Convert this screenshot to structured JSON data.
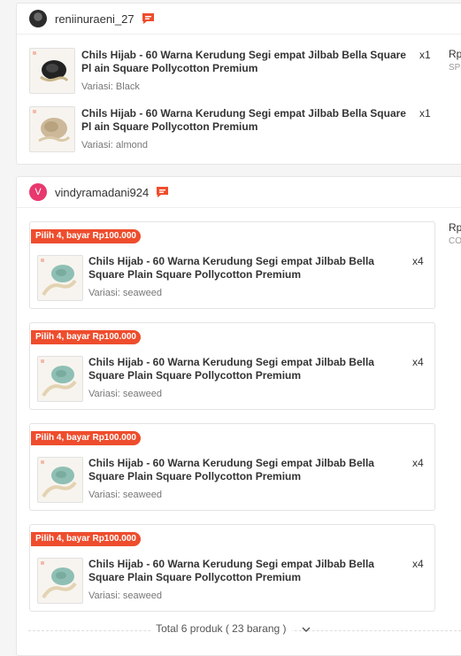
{
  "orders": [
    {
      "username": "reniinuraeni_27",
      "price_partial": "Rp",
      "price_sub": "SPa",
      "items": [
        {
          "title": "Chils Hijab - 60 Warna Kerudung Segi empat Jilbab Bella Square Pl ain Square Pollycotton Premium",
          "qty": "x1",
          "variant": "Variasi: Black"
        },
        {
          "title": "Chils Hijab - 60 Warna Kerudung Segi empat Jilbab Bella Square Pl ain Square Pollycotton Premium",
          "qty": "x1",
          "variant": "Variasi: almond"
        }
      ]
    },
    {
      "username": "vindyramadani924",
      "avatar_letter": "V",
      "price_partial": "Rp",
      "price_sub": "CO",
      "bundles": [
        {
          "badge": "Pilih 4, bayar Rp100.000",
          "title": "Chils Hijab - 60 Warna Kerudung Segi empat Jilbab Bella Square Plain Square Pollycotton Premium",
          "qty": "x4",
          "variant": "Variasi: seaweed"
        },
        {
          "badge": "Pilih 4, bayar Rp100.000",
          "title": "Chils Hijab - 60 Warna Kerudung Segi empat Jilbab Bella Square Plain Square Pollycotton Premium",
          "qty": "x4",
          "variant": "Variasi: seaweed"
        },
        {
          "badge": "Pilih 4, bayar Rp100.000",
          "title": "Chils Hijab - 60 Warna Kerudung Segi empat Jilbab Bella Square Plain Square Pollycotton Premium",
          "qty": "x4",
          "variant": "Variasi: seaweed"
        },
        {
          "badge": "Pilih 4, bayar Rp100.000",
          "title": "Chils Hijab - 60 Warna Kerudung Segi empat Jilbab Bella Square Plain Square Pollycotton Premium",
          "qty": "x4",
          "variant": "Variasi: seaweed"
        }
      ]
    }
  ],
  "footer": {
    "total_label": "Total 6 produk ( 23 barang )"
  },
  "colors": {
    "accent": "#ee4d2d",
    "avatar_pink": "#e8386e"
  },
  "icons": {
    "chat": "chat-icon",
    "expand": "chevron-down-icon"
  }
}
